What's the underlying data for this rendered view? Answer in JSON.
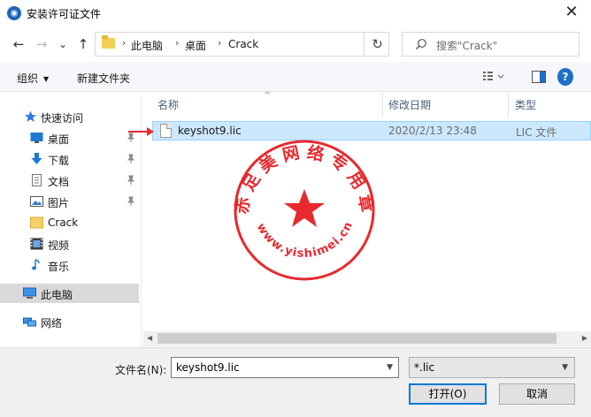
{
  "window": {
    "title": "安装许可证文件",
    "close_glyph": "✕"
  },
  "nav": {
    "back_glyph": "←",
    "forward_glyph": "→",
    "history_glyph": "⌄",
    "up_glyph": "↑",
    "breadcrumbs": [
      "此电脑",
      "桌面",
      "Crack"
    ],
    "breadcrumb_separator": "›",
    "refresh_glyph": "↻",
    "search_placeholder": "搜索\"Crack\""
  },
  "toolbar": {
    "organize_label": "组织",
    "new_folder_label": "新建文件夹"
  },
  "sidebar": {
    "items": [
      {
        "label": "快速访问",
        "icon": "star-icon",
        "pinned": false
      },
      {
        "label": "桌面",
        "icon": "desktop-icon",
        "pinned": true
      },
      {
        "label": "下载",
        "icon": "download-icon",
        "pinned": true
      },
      {
        "label": "文档",
        "icon": "document-icon",
        "pinned": true
      },
      {
        "label": "图片",
        "icon": "picture-icon",
        "pinned": true
      },
      {
        "label": "Crack",
        "icon": "folder-icon",
        "pinned": false
      },
      {
        "label": "视频",
        "icon": "video-icon",
        "pinned": false
      },
      {
        "label": "音乐",
        "icon": "music-icon",
        "pinned": false
      },
      {
        "label": "此电脑",
        "icon": "computer-icon",
        "pinned": false,
        "selected": true
      },
      {
        "label": "网络",
        "icon": "network-icon",
        "pinned": false
      }
    ]
  },
  "filelist": {
    "columns": [
      "名称",
      "修改日期",
      "类型"
    ],
    "sort_glyph": "^",
    "rows": [
      {
        "name": "keyshot9.lic",
        "date": "2020/2/13 23:48",
        "type": "LIC 文件",
        "selected": true
      }
    ]
  },
  "watermark": {
    "arc_text": "赤 足 美 网 络 专 用 章",
    "url_text": "www.yishimei.cn",
    "color": "#e8292e"
  },
  "bottom": {
    "filename_label": "文件名(N):",
    "filename_value": "keyshot9.lic",
    "filetype_value": "*.lic",
    "open_label": "打开(O)",
    "cancel_label": "取消"
  },
  "colors": {
    "accent": "#0078d7",
    "selection": "#cce8ff",
    "annotation_red": "#e8292e"
  }
}
